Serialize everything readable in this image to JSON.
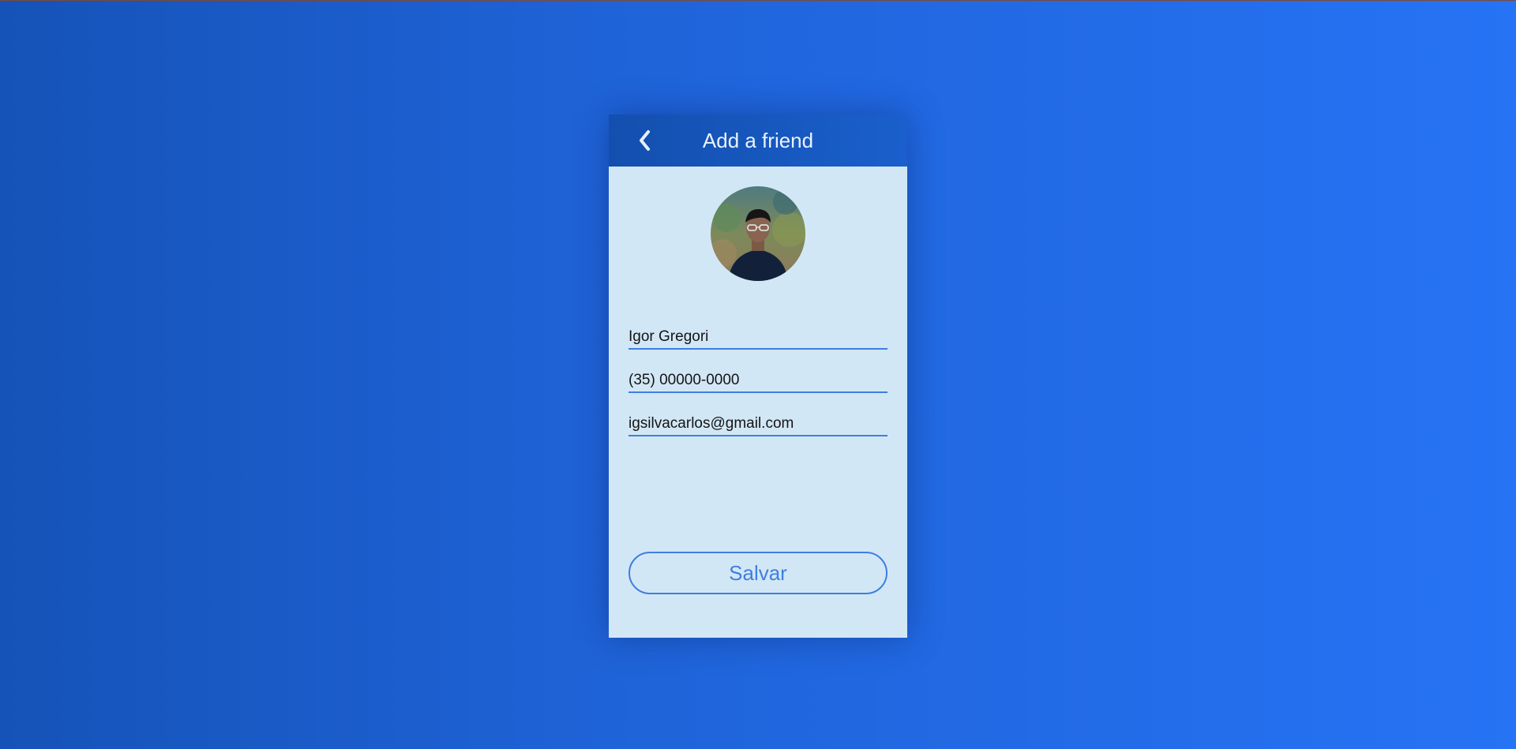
{
  "header": {
    "back_icon": "chevron-left-icon",
    "title": "Add a friend"
  },
  "form": {
    "name_value": "Igor Gregori",
    "phone_value": "(35) 00000-0000",
    "email_value": "igsilvacarlos@gmail.com",
    "save_label": "Salvar"
  },
  "colors": {
    "accent": "#3e7ee0",
    "card_background": "#d2e7f6",
    "header_background": "#1654b8"
  }
}
